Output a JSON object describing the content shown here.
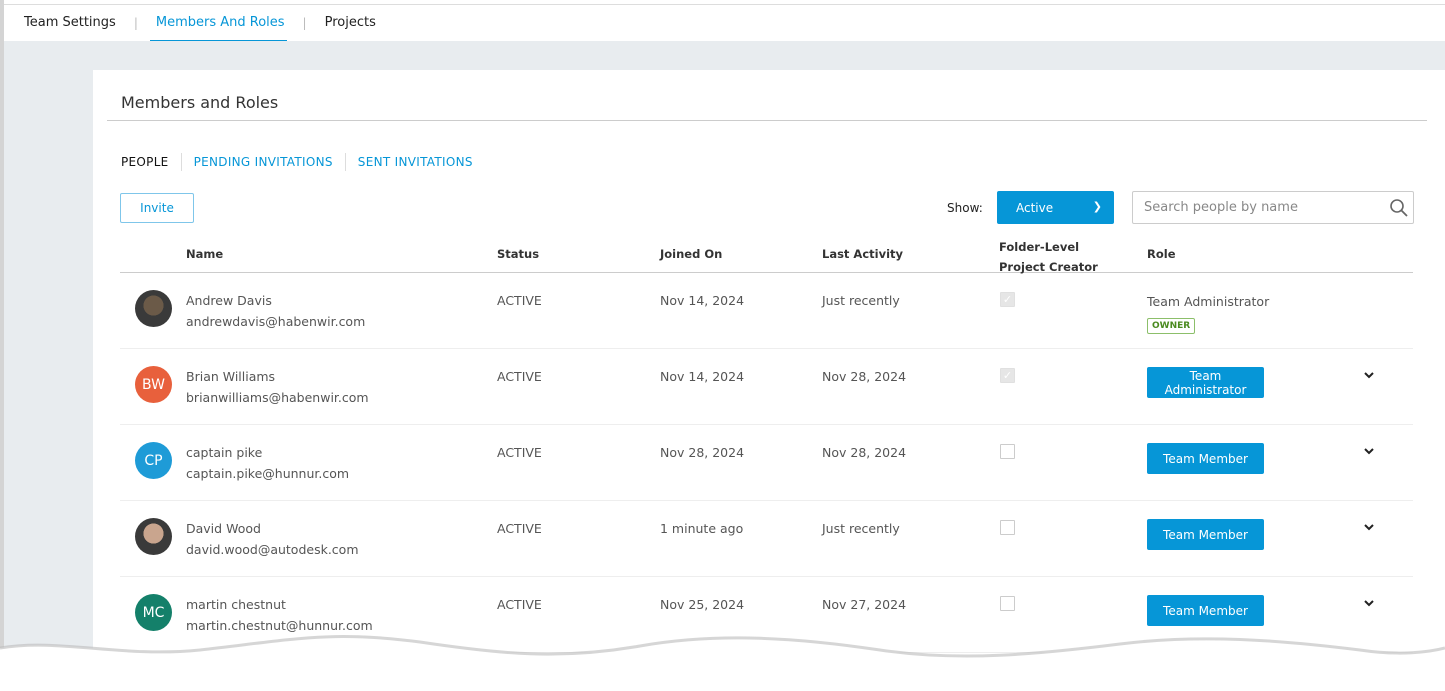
{
  "top_tabs": [
    {
      "label": "Team Settings"
    },
    {
      "label": "Members And Roles",
      "active": true
    },
    {
      "label": "Projects"
    }
  ],
  "page_title": "Members and Roles",
  "sub_tabs": [
    {
      "label": "PEOPLE",
      "active": true
    },
    {
      "label": "PENDING INVITATIONS"
    },
    {
      "label": "SENT INVITATIONS"
    }
  ],
  "toolbar": {
    "invite_label": "Invite",
    "show_label": "Show:",
    "show_value": "Active",
    "search_placeholder": "Search people by name"
  },
  "columns": {
    "name": "Name",
    "status": "Status",
    "joined": "Joined On",
    "last": "Last Activity",
    "folder": "Folder-Level Project Creator",
    "role": "Role"
  },
  "colors": {
    "accent": "#0696d7",
    "owner_badge": "#4a8a1f"
  },
  "members": [
    {
      "name": "Andrew Davis",
      "email": "andrewdavis@habenwir.com",
      "status": "ACTIVE",
      "joined": "Nov 14, 2024",
      "last": "Just recently",
      "folder_creator": true,
      "folder_disabled": true,
      "role": "Team Administrator",
      "badge": "OWNER",
      "avatar": "photo",
      "avatar_color": "#6b5a48"
    },
    {
      "name": "Brian Williams",
      "email": "brianwilliams@habenwir.com",
      "status": "ACTIVE",
      "joined": "Nov 14, 2024",
      "last": "Nov 28, 2024",
      "folder_creator": true,
      "folder_disabled": true,
      "role": "Team Administrator",
      "initials": "BW",
      "avatar_color": "#e8603c"
    },
    {
      "name": "captain pike",
      "email": "captain.pike@hunnur.com",
      "status": "ACTIVE",
      "joined": "Nov 28, 2024",
      "last": "Nov 28, 2024",
      "folder_creator": false,
      "role": "Team Member",
      "initials": "CP",
      "avatar_color": "#1e9bd7"
    },
    {
      "name": "David Wood",
      "email": "david.wood@autodesk.com",
      "status": "ACTIVE",
      "joined": "1 minute ago",
      "last": "Just recently",
      "folder_creator": false,
      "role": "Team Member",
      "avatar": "photo",
      "avatar_color": "#c9a58e"
    },
    {
      "name": "martin chestnut",
      "email": "martin.chestnut@hunnur.com",
      "status": "ACTIVE",
      "joined": "Nov 25, 2024",
      "last": "Nov 27, 2024",
      "folder_creator": false,
      "role": "Team Member",
      "initials": "MC",
      "avatar_color": "#14806a"
    }
  ]
}
